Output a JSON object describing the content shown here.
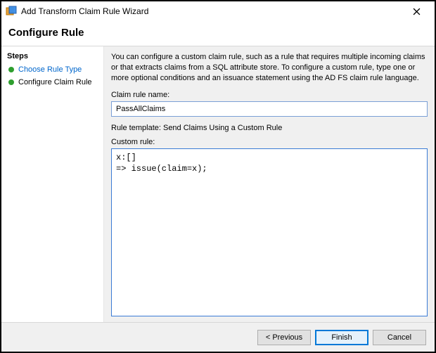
{
  "window": {
    "title": "Add Transform Claim Rule Wizard"
  },
  "header": {
    "title": "Configure Rule"
  },
  "sidebar": {
    "heading": "Steps",
    "items": [
      {
        "label": "Choose Rule Type",
        "current": true
      },
      {
        "label": "Configure Claim Rule",
        "current": false
      }
    ]
  },
  "main": {
    "description": "You can configure a custom claim rule, such as a rule that requires multiple incoming claims or that extracts claims from a SQL attribute store. To configure a custom rule, type one or more optional conditions and an issuance statement using the AD FS claim rule language.",
    "claim_rule_name_label": "Claim rule name:",
    "claim_rule_name_value": "PassAllClaims",
    "rule_template_label": "Rule template: Send Claims Using a Custom Rule",
    "custom_rule_label": "Custom rule:",
    "custom_rule_value": "x:[]\n=> issue(claim=x);"
  },
  "buttons": {
    "previous": "< Previous",
    "finish": "Finish",
    "cancel": "Cancel"
  }
}
